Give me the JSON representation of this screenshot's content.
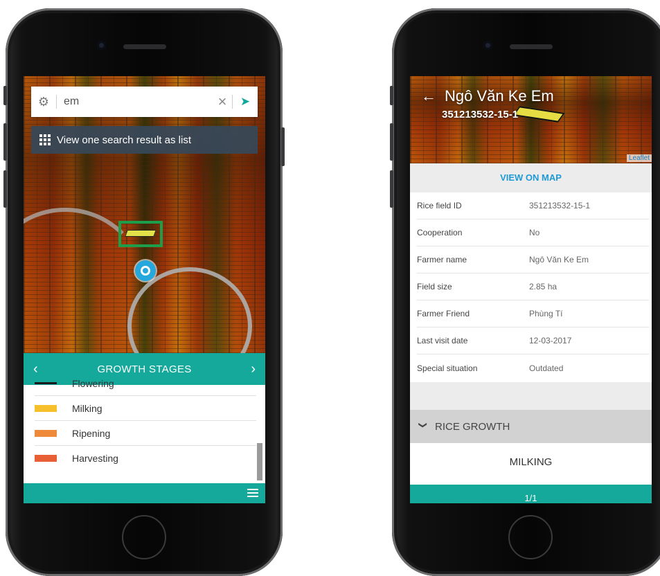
{
  "left_screen": {
    "search": {
      "value": "em",
      "settings_icon": "gear-icon",
      "clear_icon": "close-icon",
      "locate_icon": "navigation-arrow-icon"
    },
    "list_bar": {
      "label": "View one search result as list",
      "icon": "grid-icon"
    },
    "growth_stages": {
      "title": "GROWTH STAGES",
      "prev_label": "‹",
      "next_label": "›",
      "items": [
        {
          "label": "Flowering",
          "color": "#1b1b1b"
        },
        {
          "label": "Milking",
          "color": "#f6bf2c"
        },
        {
          "label": "Ripening",
          "color": "#ef8a3a"
        },
        {
          "label": "Harvesting",
          "color": "#e85f35"
        }
      ]
    },
    "bottom_icon": "list-icon"
  },
  "right_screen": {
    "header": {
      "title": "Ngô Văn Ke Em",
      "subtitle": "351213532-15-1",
      "back_icon": "arrow-left-icon",
      "attribution": "Leaflet"
    },
    "view_on_map": "VIEW ON MAP",
    "details": [
      {
        "key": "Rice field ID",
        "value": "351213532-15-1"
      },
      {
        "key": "Cooperation",
        "value": "No"
      },
      {
        "key": "Farmer name",
        "value": "Ngô Văn Ke Em"
      },
      {
        "key": "Field size",
        "value": "2.85 ha"
      },
      {
        "key": "Farmer Friend",
        "value": "Phùng Tí"
      },
      {
        "key": "Last visit date",
        "value": "12-03-2017"
      },
      {
        "key": "Special situation",
        "value": "Outdated"
      }
    ],
    "rice_growth": {
      "label": "RICE GROWTH",
      "stage": "MILKING"
    },
    "pager": "1/1"
  },
  "colors": {
    "accent": "#15a99b",
    "link": "#1f9ad6",
    "list_bar": "#374859"
  }
}
